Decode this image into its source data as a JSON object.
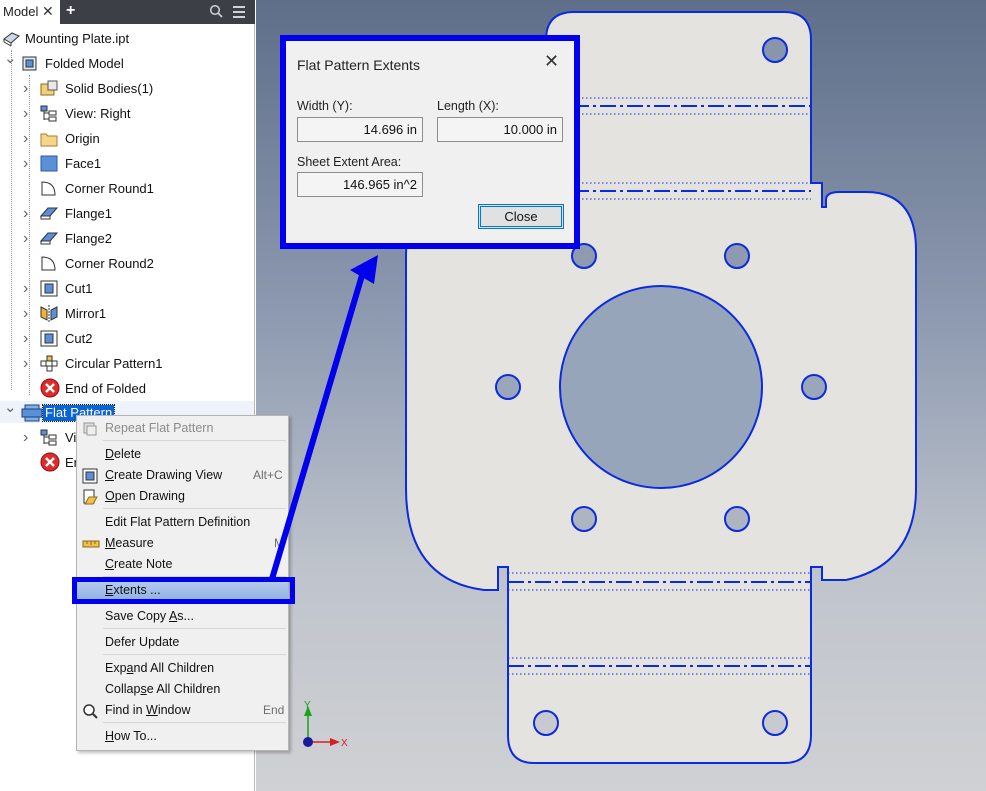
{
  "browser": {
    "tab_label": "Model",
    "tab_close": "✕",
    "tab_add": "+",
    "root_label": "Mounting Plate.ipt",
    "folded_label": "Folded Model",
    "items": [
      {
        "label": "Solid Bodies(1)",
        "icon": "solid-bodies-icon"
      },
      {
        "label": "View: Right",
        "icon": "view-icon"
      },
      {
        "label": "Origin",
        "icon": "folder-icon"
      },
      {
        "label": "Face1",
        "icon": "face-icon"
      },
      {
        "label": "Corner Round1",
        "icon": "corner-round-icon"
      },
      {
        "label": "Flange1",
        "icon": "flange-icon"
      },
      {
        "label": "Flange2",
        "icon": "flange-icon"
      },
      {
        "label": "Corner Round2",
        "icon": "corner-round-icon"
      },
      {
        "label": "Cut1",
        "icon": "cut-icon"
      },
      {
        "label": "Mirror1",
        "icon": "mirror-icon"
      },
      {
        "label": "Cut2",
        "icon": "cut-icon"
      },
      {
        "label": "Circular Pattern1",
        "icon": "circular-pattern-icon"
      },
      {
        "label": "End of Folded",
        "icon": "end-of-part-icon"
      }
    ],
    "flat_pattern_label": "Flat Pattern",
    "flat_children": [
      {
        "label": "View: Master",
        "icon": "view-icon"
      },
      {
        "label": "End of Flat",
        "icon": "end-of-part-icon"
      }
    ]
  },
  "context_menu": {
    "items": [
      {
        "label": "Repeat Flat Pattern",
        "shortcut": "",
        "disabled": true,
        "icon": "repeat-icon"
      },
      {
        "label": "Delete",
        "shortcut": "",
        "disabled": false,
        "icon": ""
      },
      {
        "label": "Create Drawing View",
        "shortcut": "Alt+C",
        "disabled": false,
        "icon": "drawing-view-icon"
      },
      {
        "label": "Open Drawing",
        "shortcut": "",
        "disabled": false,
        "icon": "open-drawing-icon"
      },
      {
        "label": "Edit Flat Pattern Definition",
        "shortcut": "",
        "disabled": false,
        "icon": ""
      },
      {
        "label": "Measure",
        "shortcut": "M",
        "disabled": false,
        "icon": "measure-icon"
      },
      {
        "label": "Create Note",
        "shortcut": "",
        "disabled": false,
        "icon": ""
      },
      {
        "label": "Extents ...",
        "shortcut": "",
        "disabled": false,
        "icon": ""
      },
      {
        "label": "Save Copy As...",
        "shortcut": "",
        "disabled": false,
        "icon": ""
      },
      {
        "label": "Defer Update",
        "shortcut": "",
        "disabled": false,
        "icon": ""
      },
      {
        "label": "Expand All Children",
        "shortcut": "",
        "disabled": false,
        "icon": ""
      },
      {
        "label": "Collapse All Children",
        "shortcut": "",
        "disabled": false,
        "icon": ""
      },
      {
        "label": "Find in Window",
        "shortcut": "End",
        "disabled": false,
        "icon": "find-icon"
      },
      {
        "label": "How To...",
        "shortcut": "",
        "disabled": false,
        "icon": ""
      }
    ],
    "selected": "Extents ..."
  },
  "dialog": {
    "title": "Flat Pattern Extents",
    "close_glyph": "✕",
    "width_label": "Width (Y):",
    "width_value": "14.696 in",
    "length_label": "Length (X):",
    "length_value": "10.000 in",
    "area_label": "Sheet Extent Area:",
    "area_value": "146.965 in^2",
    "close_button": "Close"
  },
  "viewport": {
    "axis_y": "Y",
    "axis_x": "X"
  },
  "colors": {
    "annotation_blue": "#0000ee",
    "edge_blue": "#0a2be0",
    "selection_blue": "#0a64d6",
    "tab_bar": "#3c3f45"
  }
}
